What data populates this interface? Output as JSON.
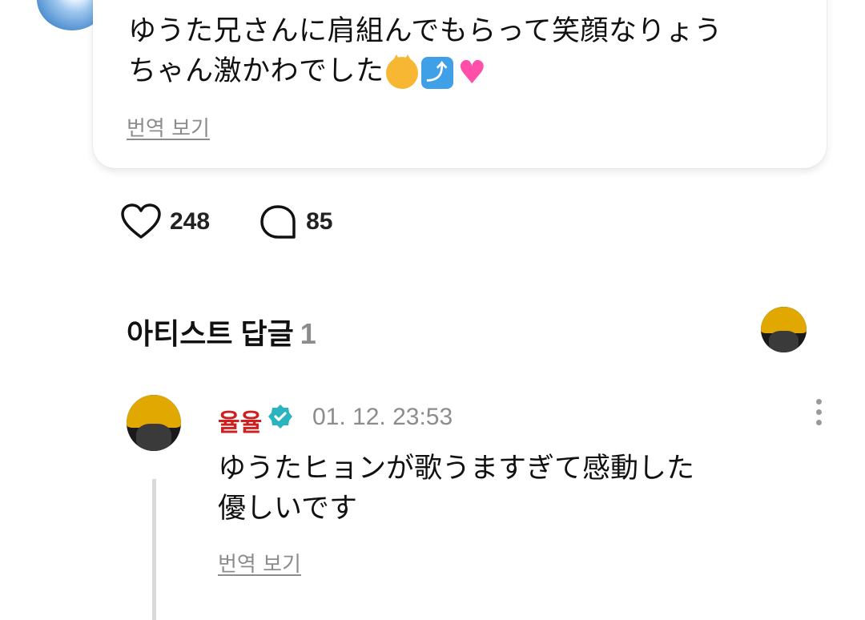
{
  "post": {
    "text_line1": "ゆうた兄さんに肩組んでもらって笑顔なりょう",
    "text_line2": "ちゃん激かわでした",
    "emojis": [
      "cat-kissing-emoji",
      "arrow-up-emoji",
      "sparkling-heart-emoji"
    ],
    "translate_label": "번역 보기"
  },
  "stats": {
    "likes": "248",
    "comments": "85"
  },
  "artist_replies": {
    "title": "아티스트 답글",
    "count": "1"
  },
  "reply": {
    "author": "율율",
    "timestamp": "01. 12. 23:53",
    "text_line1": "ゆうたヒョンが歌うますぎて感動した",
    "text_line2": "優しいです",
    "translate_label": "번역 보기"
  },
  "colors": {
    "artist_name": "#d01f1f",
    "verified_badge": "#2bb3c0",
    "muted_text": "#8c8c8c"
  }
}
